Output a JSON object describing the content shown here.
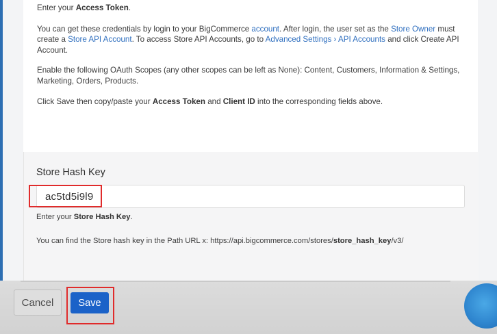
{
  "token_help": {
    "p1": [
      "Enter your ",
      "Access Token",
      "."
    ],
    "p2": [
      "You can get these credentials by login to your BigCommerce ",
      "account",
      ". After login, the user set as the ",
      "Store Owner",
      " must create a ",
      "Store API Account",
      ". To access Store API Accounts, go to ",
      "Advanced Settings",
      " › ",
      "API Accounts",
      " and click Create API Account."
    ],
    "p3": "Enable the following OAuth Scopes (any other scopes can be left as None): Content, Customers, Information & Settings, Marketing, Orders, Products.",
    "p4": [
      "Click Save then copy/paste your ",
      "Access Token",
      " and ",
      "Client ID",
      " into the corresponding fields above."
    ]
  },
  "store_hash": {
    "label": "Store Hash Key",
    "value": "ac5td5i9l9",
    "helper": [
      "Enter your ",
      "Store Hash Key",
      "."
    ],
    "path": [
      "You can find the Store hash key in the Path URL x: https://api.bigcommerce.com/stores/",
      "store_hash_key",
      "/v3/"
    ]
  },
  "footer": {
    "cancel_label": "Cancel",
    "save_label": "Save"
  },
  "colors": {
    "link": "#2f6fbf",
    "save": "#1b62c8",
    "highlight": "#e02b2b"
  }
}
